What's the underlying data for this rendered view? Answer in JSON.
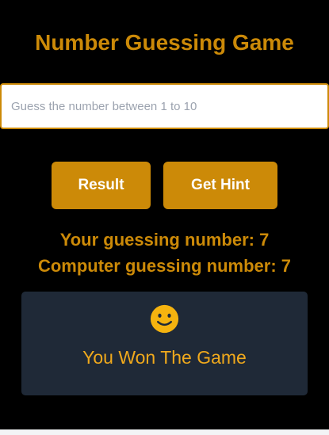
{
  "header": {
    "title": "Number Guessing Game"
  },
  "input": {
    "placeholder": "Guess the number between 1 to 10",
    "value": ""
  },
  "buttons": {
    "result_label": "Result",
    "hint_label": "Get Hint"
  },
  "guesses": {
    "user_line": "Your guessing number: 7",
    "computer_line": "Computer guessing number: 7"
  },
  "result": {
    "icon": "smiley-face-icon",
    "message": "You Won The Game"
  },
  "colors": {
    "accent": "#cc8a08",
    "background": "#000000",
    "card": "#1f2937",
    "result_text": "#f0a91c",
    "icon": "#f5b30f"
  }
}
